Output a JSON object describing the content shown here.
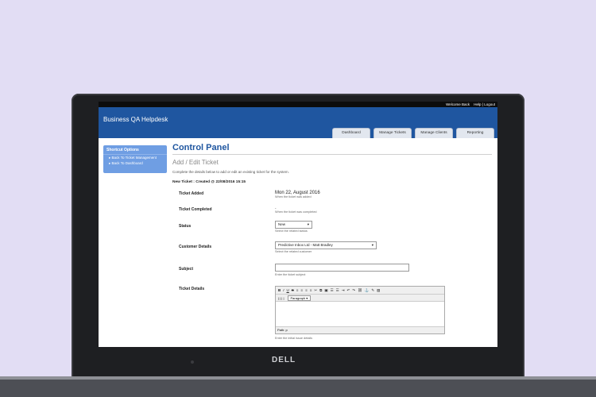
{
  "topbar": {
    "welcome": "Welcome Back",
    "help_logout": "Help | Logout"
  },
  "header": {
    "brand": "Business QA Helpdesk"
  },
  "tabs": [
    {
      "label": "Dashboard"
    },
    {
      "label": "Manage Tickets"
    },
    {
      "label": "Manage Clients"
    },
    {
      "label": "Reporting"
    }
  ],
  "sidebar": {
    "title": "Shortcut Options",
    "items": [
      {
        "label": "Back To Ticket Management"
      },
      {
        "label": "Back To Dashboard"
      }
    ]
  },
  "main": {
    "title": "Control Panel",
    "subtitle": "Add / Edit Ticket",
    "description": "Complete the details below to add or edit an existing ticket for the system.",
    "new_ticket": "New Ticket : Created @ 22/08/2016 15:15"
  },
  "form": {
    "ticket_added": {
      "label": "Ticket Added",
      "value": "Mon 22, August 2016",
      "hint": "When the ticket was added"
    },
    "ticket_completed": {
      "label": "Ticket Completed",
      "value": "-",
      "hint": "When the ticket was completed"
    },
    "status": {
      "label": "Status",
      "value": "New",
      "hint": "Select the related status"
    },
    "customer": {
      "label": "Customer Details",
      "value": "Predictive Inbox Ltd - Matt Bradley",
      "hint": "Select the related customer"
    },
    "subject": {
      "label": "Subject",
      "value": "",
      "hint": "Enter the ticket subject"
    },
    "details": {
      "label": "Ticket Details",
      "format": "Paragraph",
      "path": "Path: p",
      "hint": "Enter the initial issue details"
    }
  },
  "device": {
    "brand": "DELL"
  }
}
